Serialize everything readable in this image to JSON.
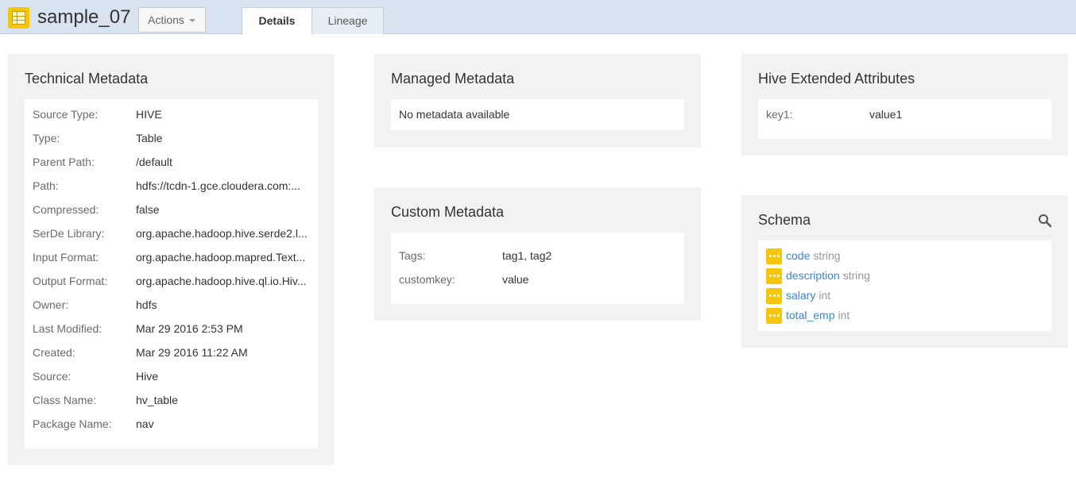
{
  "header": {
    "title": "sample_07",
    "actions_label": "Actions",
    "tabs": [
      {
        "label": "Details",
        "active": true
      },
      {
        "label": "Lineage",
        "active": false
      }
    ]
  },
  "technical": {
    "title": "Technical Metadata",
    "rows": [
      {
        "key": "Source Type:",
        "value": "HIVE"
      },
      {
        "key": "Type:",
        "value": "Table"
      },
      {
        "key": "Parent Path:",
        "value": "/default"
      },
      {
        "key": "Path:",
        "value": "hdfs://tcdn-1.gce.cloudera.com:..."
      },
      {
        "key": "Compressed:",
        "value": "false"
      },
      {
        "key": "SerDe Library:",
        "value": "org.apache.hadoop.hive.serde2.l..."
      },
      {
        "key": "Input Format:",
        "value": "org.apache.hadoop.mapred.Text..."
      },
      {
        "key": "Output Format:",
        "value": "org.apache.hadoop.hive.ql.io.Hiv..."
      },
      {
        "key": "Owner:",
        "value": "hdfs"
      },
      {
        "key": "Last Modified:",
        "value": "Mar 29 2016 2:53 PM"
      },
      {
        "key": "Created:",
        "value": "Mar 29 2016 11:22 AM"
      },
      {
        "key": "Source:",
        "value": "Hive"
      },
      {
        "key": "Class Name:",
        "value": "hv_table"
      },
      {
        "key": "Package Name:",
        "value": "nav"
      }
    ]
  },
  "managed": {
    "title": "Managed Metadata",
    "empty_text": "No metadata available"
  },
  "custom": {
    "title": "Custom Metadata",
    "rows": [
      {
        "key": "Tags:",
        "value": "tag1, tag2"
      },
      {
        "key": "customkey:",
        "value": "value"
      }
    ]
  },
  "hive_extended": {
    "title": "Hive Extended Attributes",
    "rows": [
      {
        "key": "key1:",
        "value": "value1"
      }
    ]
  },
  "schema": {
    "title": "Schema",
    "columns": [
      {
        "name": "code",
        "type": "string"
      },
      {
        "name": "description",
        "type": "string"
      },
      {
        "name": "salary",
        "type": "int"
      },
      {
        "name": "total_emp",
        "type": "int"
      }
    ]
  },
  "colors": {
    "header_bg": "#d8e3ef",
    "panel_bg": "#f2f2f2",
    "accent_yellow": "#f5c60b",
    "link_blue": "#3a87c8"
  },
  "icons": {
    "table": "table-icon",
    "column": "column-icon",
    "search": "search-icon",
    "caret": "caret-down-icon"
  }
}
